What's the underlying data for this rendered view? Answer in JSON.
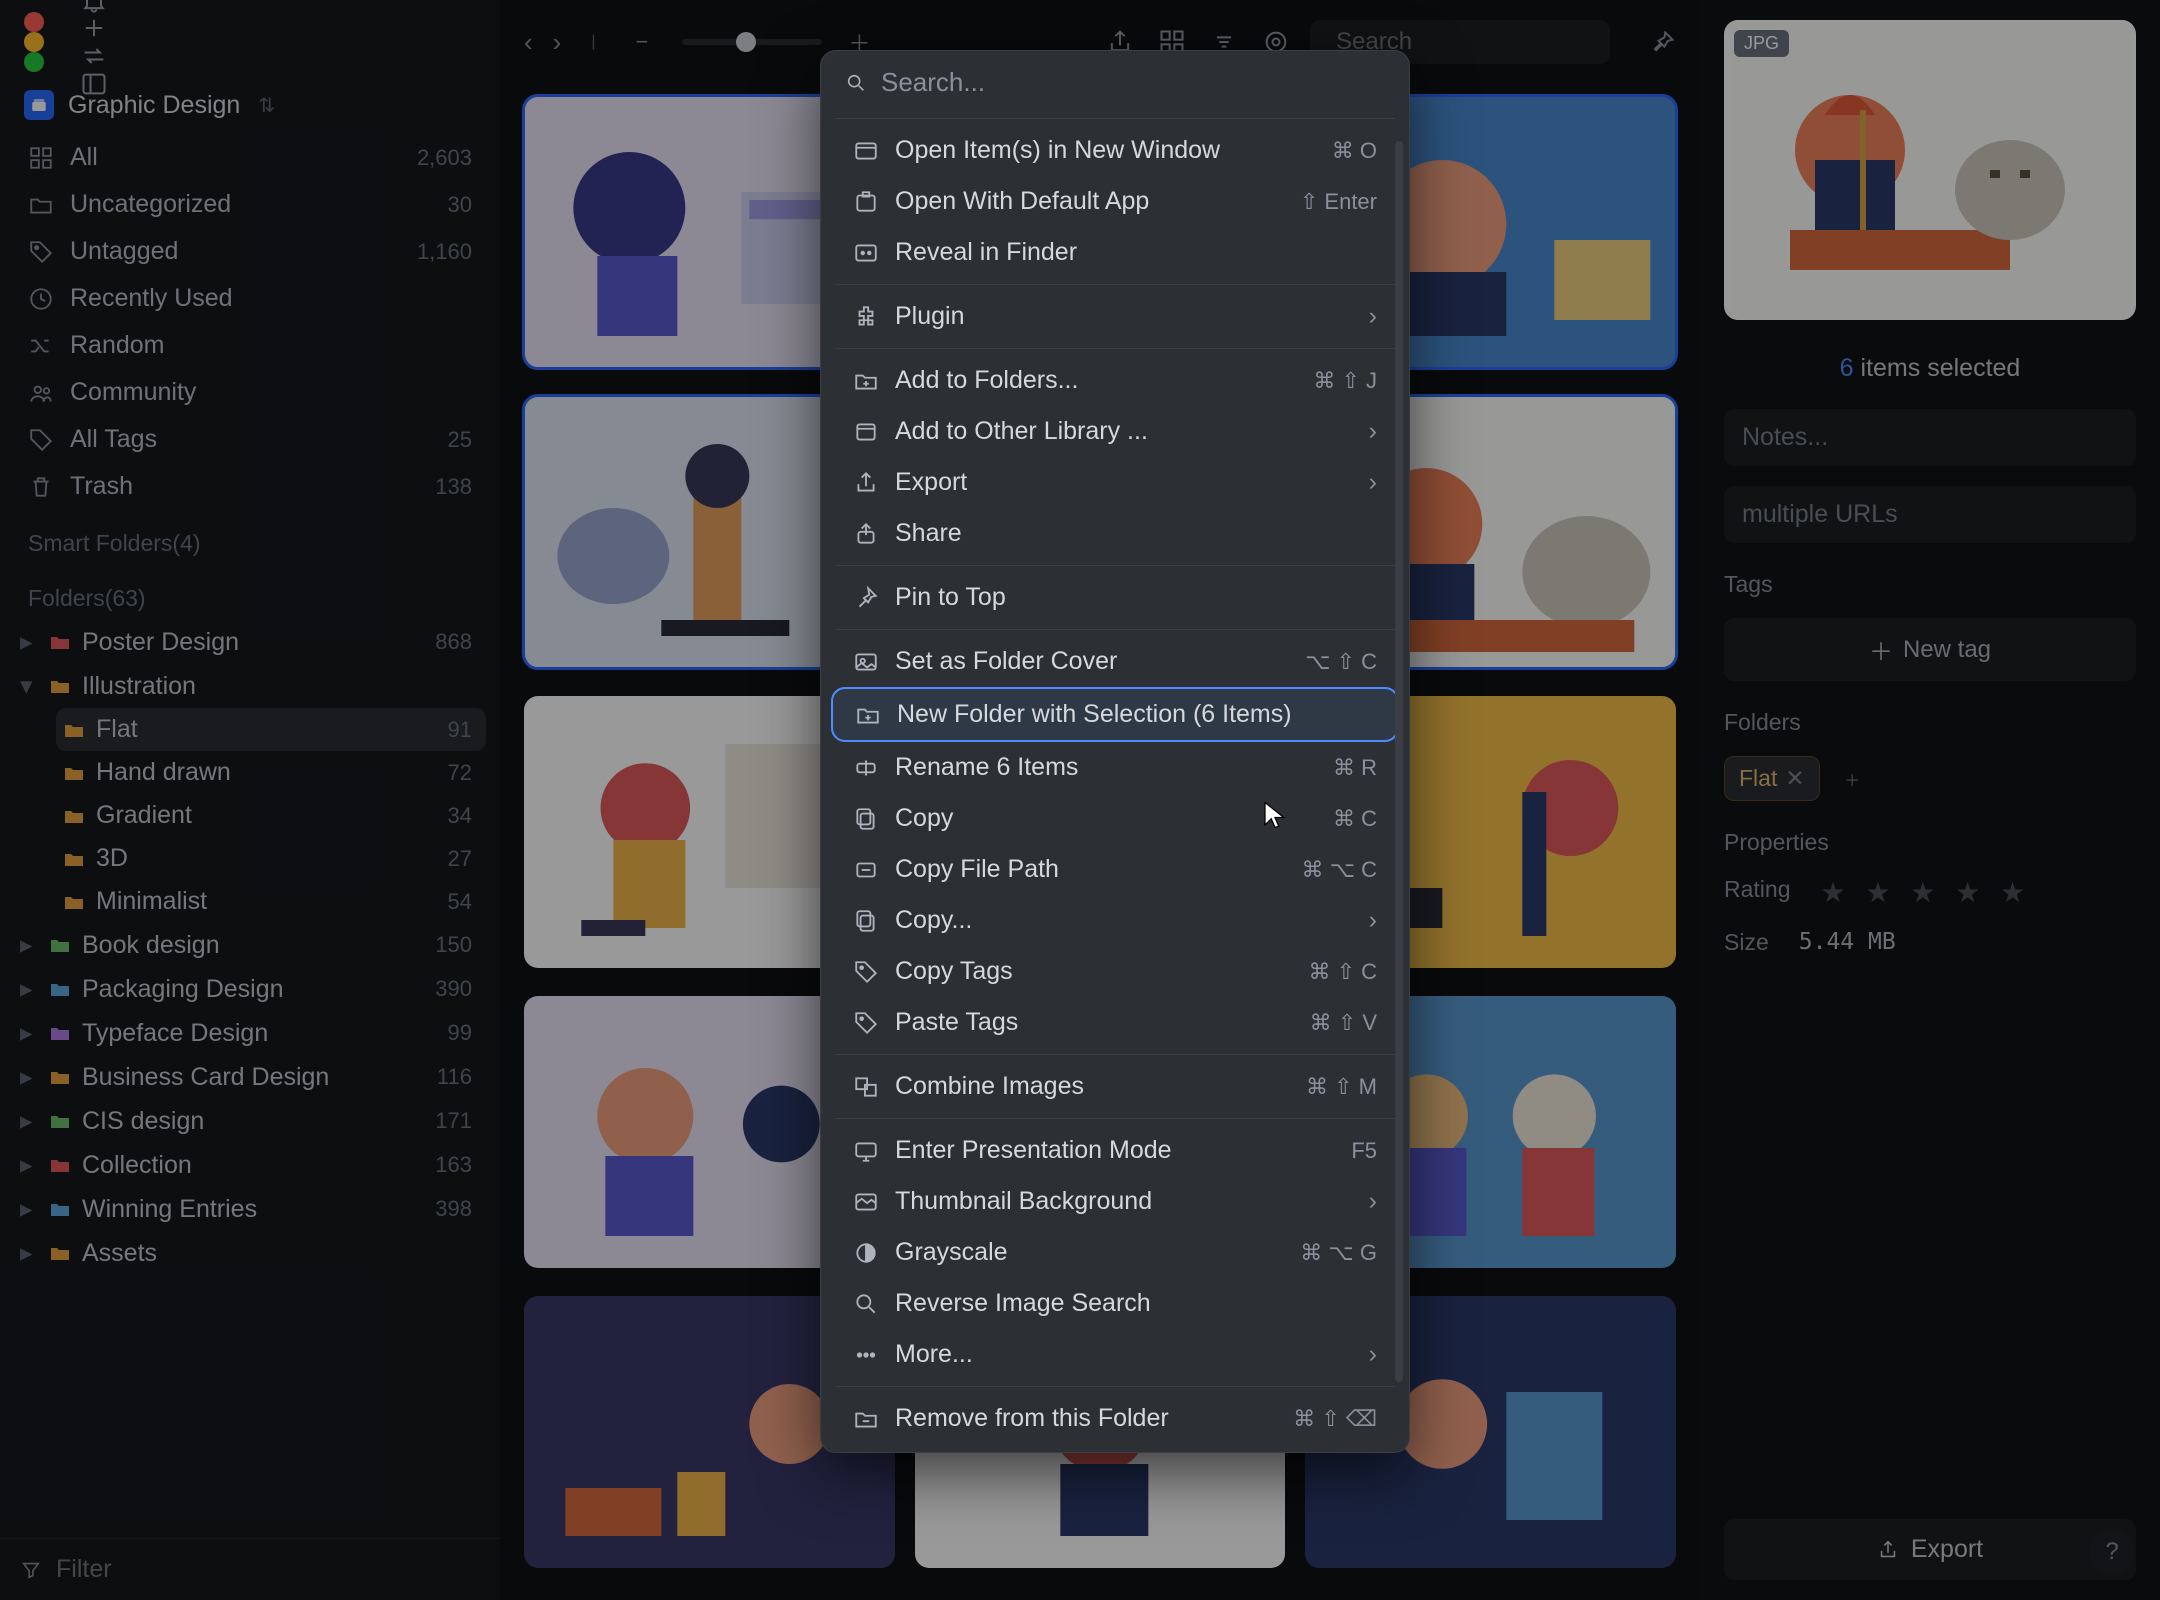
{
  "library": {
    "name": "Graphic Design"
  },
  "sidebar": {
    "smart": [
      {
        "icon": "grid",
        "label": "All",
        "count": "2,603"
      },
      {
        "icon": "folder",
        "label": "Uncategorized",
        "count": "30"
      },
      {
        "icon": "tag",
        "label": "Untagged",
        "count": "1,160"
      },
      {
        "icon": "clock",
        "label": "Recently Used",
        "count": ""
      },
      {
        "icon": "shuffle",
        "label": "Random",
        "count": ""
      },
      {
        "icon": "community",
        "label": "Community",
        "count": ""
      },
      {
        "icon": "tags",
        "label": "All Tags",
        "count": "25"
      },
      {
        "icon": "trash",
        "label": "Trash",
        "count": "138"
      }
    ],
    "sections": {
      "smart_folders": "Smart Folders(4)",
      "folders": "Folders(63)"
    },
    "folders": [
      {
        "color": "#e05a5a",
        "label": "Poster Design",
        "count": "868",
        "open": false,
        "hasChildren": true
      },
      {
        "color": "#e6a23c",
        "label": "Illustration",
        "count": "",
        "open": true,
        "hasChildren": true,
        "children": [
          {
            "color": "#e6a23c",
            "label": "Flat",
            "count": "91",
            "active": true
          },
          {
            "color": "#e6a23c",
            "label": "Hand drawn",
            "count": "72"
          },
          {
            "color": "#e6a23c",
            "label": "Gradient",
            "count": "34"
          },
          {
            "color": "#e6a23c",
            "label": "3D",
            "count": "27"
          },
          {
            "color": "#e6a23c",
            "label": "Minimalist",
            "count": "54"
          }
        ]
      },
      {
        "color": "#6bbf6b",
        "label": "Book design",
        "count": "150",
        "hasChildren": true
      },
      {
        "color": "#5aa8e0",
        "label": "Packaging Design",
        "count": "390",
        "hasChildren": true
      },
      {
        "color": "#b07ae0",
        "label": "Typeface Design",
        "count": "99",
        "hasChildren": true
      },
      {
        "color": "#e6a23c",
        "label": "Business Card Design",
        "count": "116",
        "hasChildren": true
      },
      {
        "color": "#6bbf6b",
        "label": "CIS design",
        "count": "171",
        "hasChildren": true
      },
      {
        "color": "#e05a5a",
        "label": "Collection",
        "count": "163",
        "hasChildren": true
      },
      {
        "color": "#5aa8e0",
        "label": "Winning Entries",
        "count": "398",
        "hasChildren": true
      },
      {
        "color": "#e6a23c",
        "label": "Assets",
        "count": "",
        "hasChildren": true
      }
    ],
    "filter_placeholder": "Filter"
  },
  "toolbar": {
    "search_placeholder": "Search"
  },
  "context_menu": {
    "search_placeholder": "Search...",
    "items": [
      {
        "icon": "window",
        "label": "Open Item(s) in New Window",
        "shortcut": "⌘ O"
      },
      {
        "icon": "open",
        "label": "Open With Default App",
        "shortcut": "⇧ Enter"
      },
      {
        "icon": "finder",
        "label": "Reveal in Finder",
        "shortcut": ""
      },
      {
        "sep": true
      },
      {
        "icon": "plugin",
        "label": "Plugin",
        "submenu": true
      },
      {
        "sep": true
      },
      {
        "icon": "folderadd",
        "label": "Add to Folders...",
        "shortcut": "⌘ ⇧ J"
      },
      {
        "icon": "library",
        "label": "Add to Other Library ...",
        "submenu": true
      },
      {
        "icon": "export",
        "label": "Export",
        "submenu": true
      },
      {
        "icon": "share",
        "label": "Share"
      },
      {
        "sep": true
      },
      {
        "icon": "pin",
        "label": "Pin to Top"
      },
      {
        "sep": true
      },
      {
        "icon": "cover",
        "label": "Set as Folder Cover",
        "shortcut": "⌥ ⇧ C"
      },
      {
        "icon": "newfolder",
        "label": "New Folder with Selection (6 Items)",
        "highlight": true
      },
      {
        "icon": "rename",
        "label": "Rename 6 Items",
        "shortcut": "⌘ R"
      },
      {
        "icon": "copy",
        "label": "Copy",
        "shortcut": "⌘ C"
      },
      {
        "icon": "path",
        "label": "Copy File Path",
        "shortcut": "⌘ ⌥ C"
      },
      {
        "icon": "copy",
        "label": "Copy...",
        "submenu": true
      },
      {
        "icon": "tag",
        "label": "Copy Tags",
        "shortcut": "⌘ ⇧ C"
      },
      {
        "icon": "tag",
        "label": "Paste Tags",
        "shortcut": "⌘ ⇧ V"
      },
      {
        "sep": true
      },
      {
        "icon": "combine",
        "label": "Combine Images",
        "shortcut": "⌘ ⇧ M"
      },
      {
        "sep": true
      },
      {
        "icon": "present",
        "label": "Enter Presentation Mode",
        "shortcut": "F5"
      },
      {
        "icon": "thumb",
        "label": "Thumbnail Background",
        "submenu": true
      },
      {
        "icon": "gray",
        "label": "Grayscale",
        "shortcut": "⌘ ⌥ G"
      },
      {
        "icon": "reverse",
        "label": "Reverse Image Search"
      },
      {
        "icon": "more",
        "label": "More...",
        "submenu": true
      },
      {
        "sep": true
      },
      {
        "icon": "remove",
        "label": "Remove from this Folder",
        "shortcut": "⌘ ⇧ ⌫"
      }
    ]
  },
  "inspector": {
    "badge": "JPG",
    "selected_count": "6",
    "selected_suffix": "items selected",
    "notes_placeholder": "Notes...",
    "urls_placeholder": "multiple URLs",
    "tags_label": "Tags",
    "new_tag": "New tag",
    "folders_label": "Folders",
    "folder_chip": "Flat",
    "properties_label": "Properties",
    "rating_label": "Rating",
    "size_label": "Size",
    "size_value": "5.44 MB",
    "export_label": "Export"
  }
}
